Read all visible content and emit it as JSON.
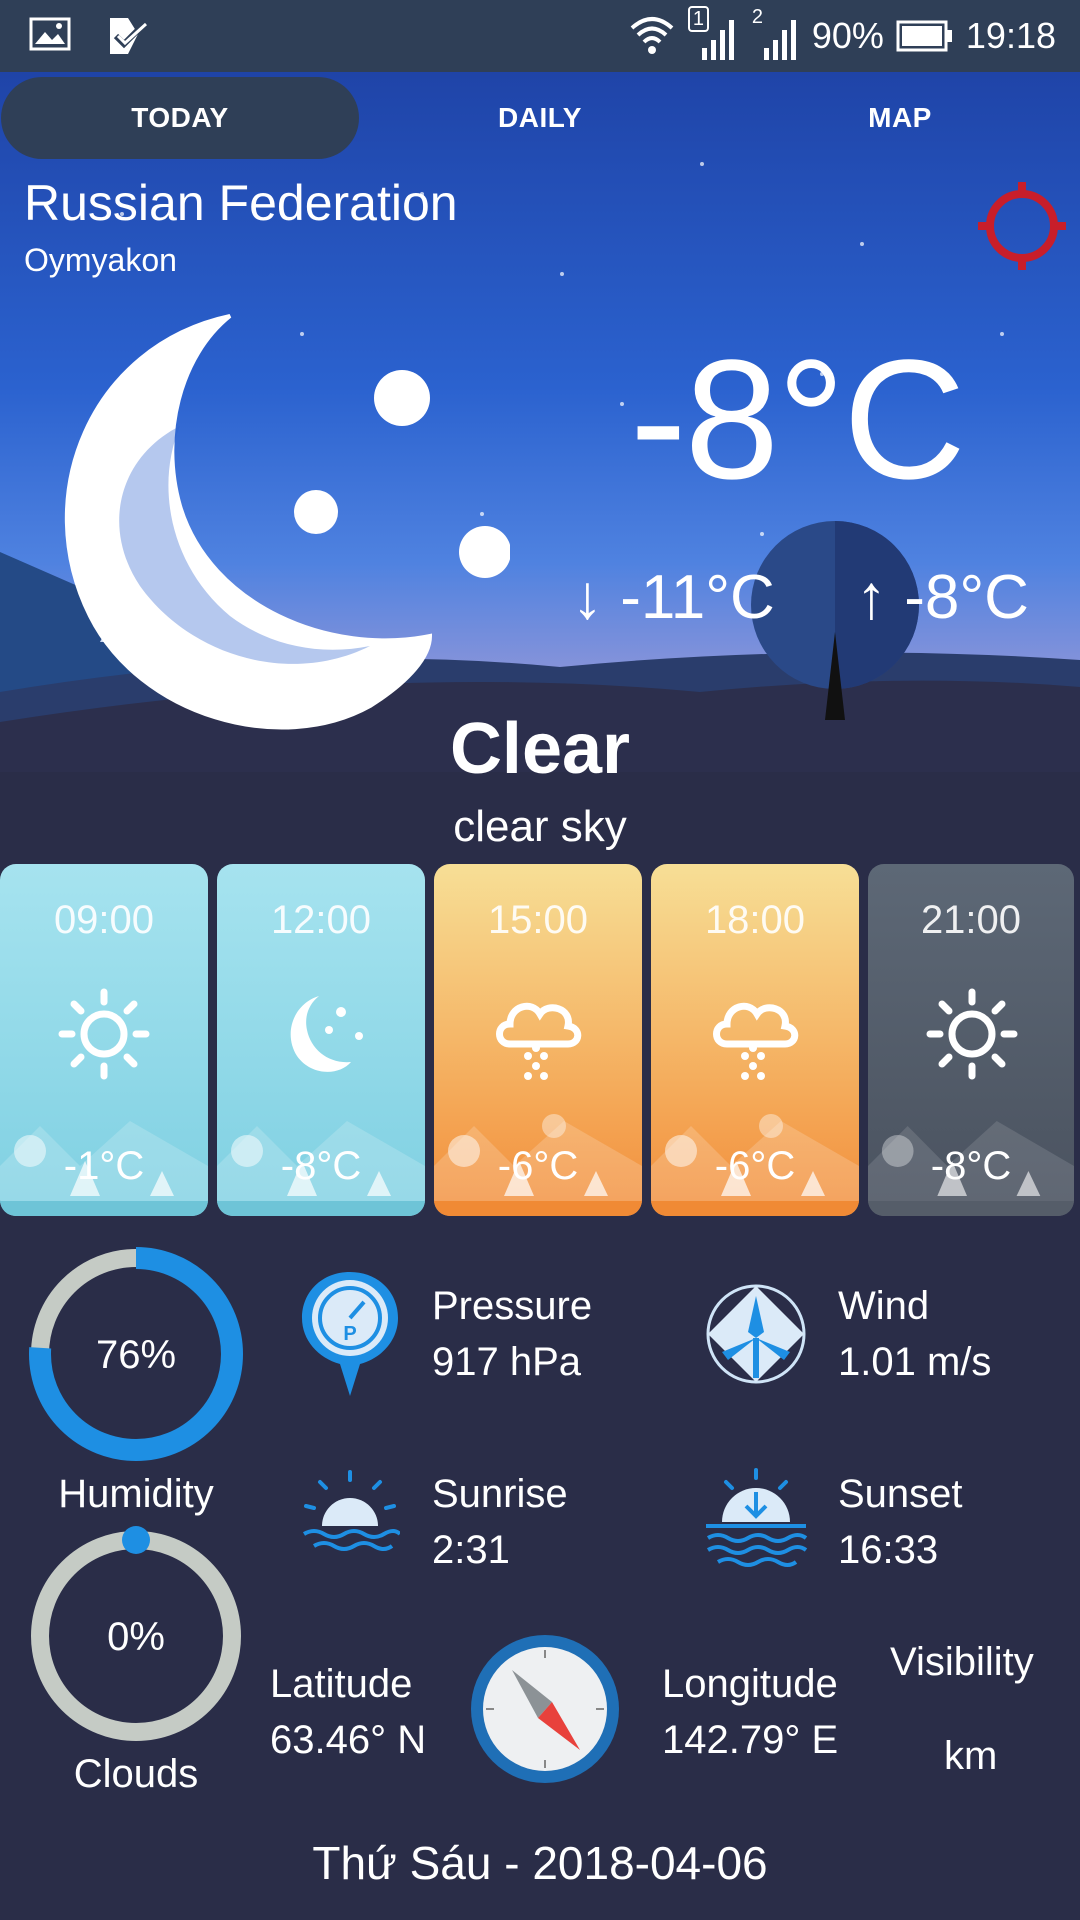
{
  "status_bar": {
    "left_icons": [
      "gallery-icon",
      "check-notification-icon"
    ],
    "battery": "90%",
    "time": "19:18",
    "sim1_label": "1",
    "sim2_label": "2"
  },
  "tabs": [
    {
      "label": "TODAY",
      "active": true
    },
    {
      "label": "DAILY",
      "active": false
    },
    {
      "label": "MAP",
      "active": false
    }
  ],
  "location": {
    "country": "Russian Federation",
    "city": "Oymyakon"
  },
  "current": {
    "temperature": "-8°C",
    "min": "↓ -11°C",
    "max": "↑ -8°C",
    "condition": "Clear",
    "description": "clear sky"
  },
  "hourly": [
    {
      "time": "09:00",
      "temp": "-1°C",
      "icon": "sun-icon",
      "theme": "light-blue"
    },
    {
      "time": "12:00",
      "temp": "-8°C",
      "icon": "moon-icon",
      "theme": "light-blue"
    },
    {
      "time": "15:00",
      "temp": "-6°C",
      "icon": "snow-cloud-icon",
      "theme": "orange"
    },
    {
      "time": "18:00",
      "temp": "-6°C",
      "icon": "snow-cloud-icon",
      "theme": "orange"
    },
    {
      "time": "21:00",
      "temp": "-8°C",
      "icon": "sun-icon",
      "theme": "gray"
    }
  ],
  "details": {
    "humidity": {
      "label": "Humidity",
      "value": "76%",
      "fraction": 0.76
    },
    "clouds": {
      "label": "Clouds",
      "value": "0%",
      "fraction": 0.0
    },
    "pressure": {
      "label": "Pressure",
      "value": "917 hPa"
    },
    "wind": {
      "label": "Wind",
      "value": "1.01 m/s"
    },
    "sunrise": {
      "label": "Sunrise",
      "value": "2:31"
    },
    "sunset": {
      "label": "Sunset",
      "value": "16:33"
    },
    "latitude": {
      "label": "Latitude",
      "value": "63.46° N"
    },
    "longitude": {
      "label": "Longitude",
      "value": "142.79° E"
    },
    "visibility": {
      "label": "Visibility",
      "value": "km"
    }
  },
  "date": "Thứ Sáu - 2018-04-06",
  "colors": {
    "accent_blue": "#1e8fe3",
    "ring_track": "#c5cbc5",
    "page_bg": "#2a2d48",
    "target_red": "#c81e2a"
  }
}
